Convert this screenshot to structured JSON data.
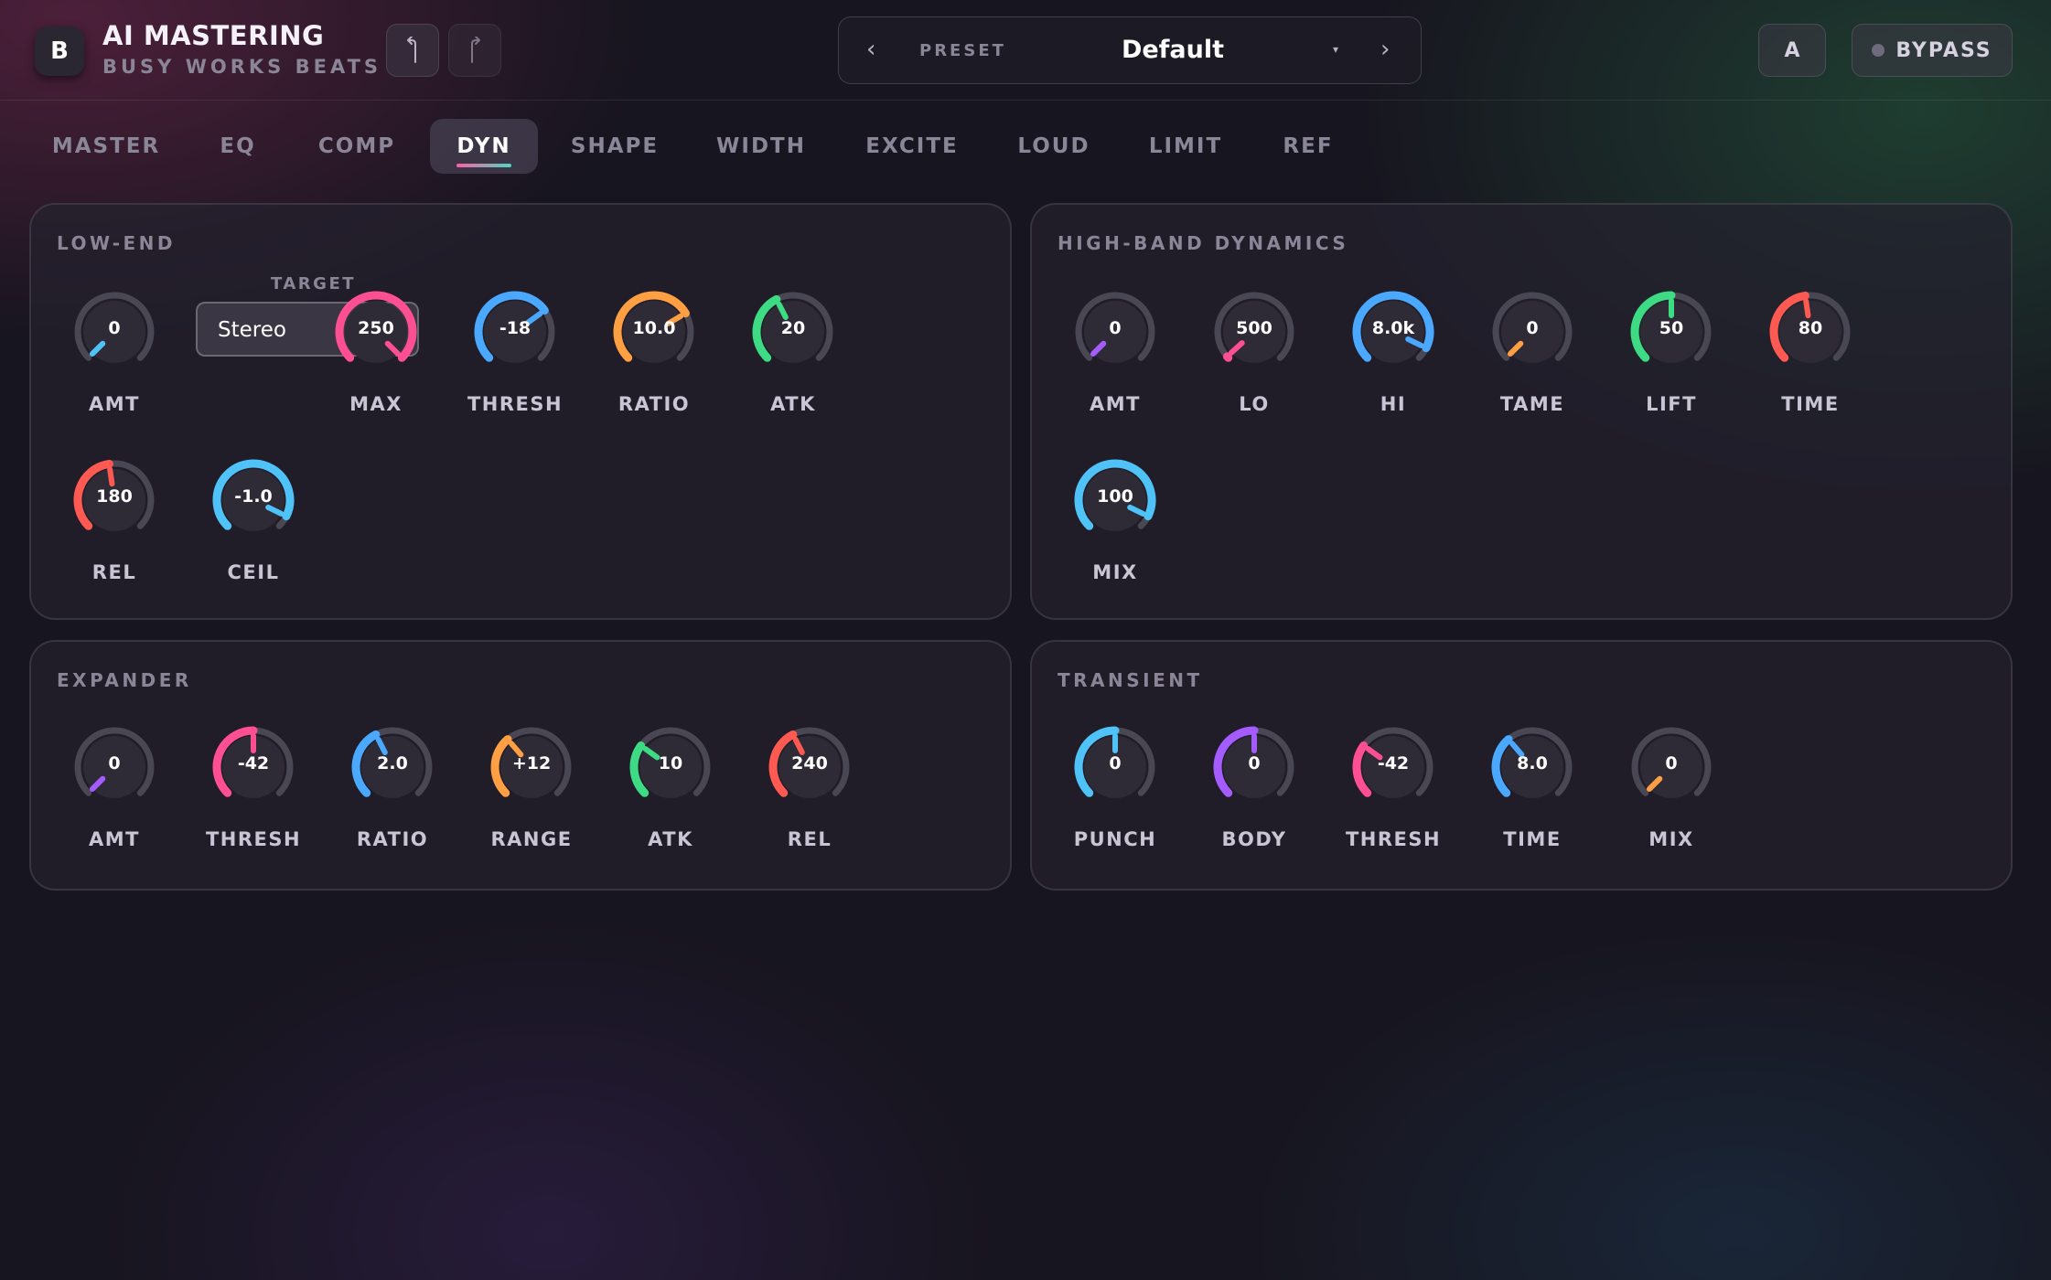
{
  "header": {
    "logo_letter": "B",
    "title": "AI MASTERING",
    "subtitle": "BUSY WORKS BEATS",
    "undo_icon": "undo-icon",
    "redo_icon": "redo-icon",
    "preset": {
      "prev": "‹",
      "label": "PRESET",
      "name": "Default",
      "caret": "▾",
      "next": "›"
    },
    "ab_label": "A",
    "bypass_label": "BYPASS"
  },
  "tabs": [
    {
      "label": "MASTER"
    },
    {
      "label": "EQ"
    },
    {
      "label": "COMP"
    },
    {
      "label": "DYN",
      "active": true
    },
    {
      "label": "SHAPE"
    },
    {
      "label": "WIDTH"
    },
    {
      "label": "EXCITE"
    },
    {
      "label": "LOUD"
    },
    {
      "label": "LIMIT"
    },
    {
      "label": "REF"
    }
  ],
  "colors": {
    "cyan": "#4fc3f7",
    "pink": "#ff4f93",
    "blue": "#4aa8ff",
    "orange": "#ff9f43",
    "green": "#3ddc84",
    "red": "#ff5a52",
    "purple": "#a45cff",
    "track": "#4a4754"
  },
  "panels": {
    "low_end": {
      "title": "LOW-END",
      "target_label": "TARGET",
      "target_value": "Stereo",
      "knobs": [
        {
          "label": "AMT",
          "value": "0",
          "level": 0,
          "color": "cyan"
        },
        {
          "label": "MAX",
          "value": "250",
          "level": 1,
          "color": "pink"
        },
        {
          "label": "THRESH",
          "value": "-18",
          "level": 0.7,
          "color": "blue"
        },
        {
          "label": "RATIO",
          "value": "10.0",
          "level": 0.72,
          "color": "orange"
        },
        {
          "label": "ATK",
          "value": "20",
          "level": 0.4,
          "color": "green"
        },
        {
          "label": "REL",
          "value": "180",
          "level": 0.47,
          "color": "red"
        },
        {
          "label": "CEIL",
          "value": "-1.0",
          "level": 0.93,
          "color": "cyan"
        }
      ]
    },
    "high_band": {
      "title": "HIGH-BAND DYNAMICS",
      "knobs": [
        {
          "label": "AMT",
          "value": "0",
          "level": 0,
          "color": "purple"
        },
        {
          "label": "LO",
          "value": "500",
          "level": 0.01,
          "color": "pink"
        },
        {
          "label": "HI",
          "value": "8.0k",
          "level": 0.93,
          "color": "blue"
        },
        {
          "label": "TAME",
          "value": "0",
          "level": 0,
          "color": "orange"
        },
        {
          "label": "LIFT",
          "value": "50",
          "level": 0.5,
          "color": "green"
        },
        {
          "label": "TIME",
          "value": "80",
          "level": 0.47,
          "color": "red"
        },
        {
          "label": "MIX",
          "value": "100",
          "level": 0.93,
          "color": "cyan"
        }
      ]
    },
    "expander": {
      "title": "EXPANDER",
      "knobs": [
        {
          "label": "AMT",
          "value": "0",
          "level": 0,
          "color": "purple"
        },
        {
          "label": "THRESH",
          "value": "-42",
          "level": 0.5,
          "color": "pink"
        },
        {
          "label": "RATIO",
          "value": "2.0",
          "level": 0.4,
          "color": "blue"
        },
        {
          "label": "RANGE",
          "value": "+12",
          "level": 0.35,
          "color": "orange"
        },
        {
          "label": "ATK",
          "value": "10",
          "level": 0.3,
          "color": "green"
        },
        {
          "label": "REL",
          "value": "240",
          "level": 0.4,
          "color": "red"
        }
      ]
    },
    "transient": {
      "title": "TRANSIENT",
      "knobs": [
        {
          "label": "PUNCH",
          "value": "0",
          "level": 0.5,
          "color": "cyan"
        },
        {
          "label": "BODY",
          "value": "0",
          "level": 0.5,
          "color": "purple"
        },
        {
          "label": "THRESH",
          "value": "-42",
          "level": 0.3,
          "color": "pink"
        },
        {
          "label": "TIME",
          "value": "8.0",
          "level": 0.35,
          "color": "blue"
        },
        {
          "label": "MIX",
          "value": "0",
          "level": 0,
          "color": "orange"
        }
      ]
    }
  }
}
